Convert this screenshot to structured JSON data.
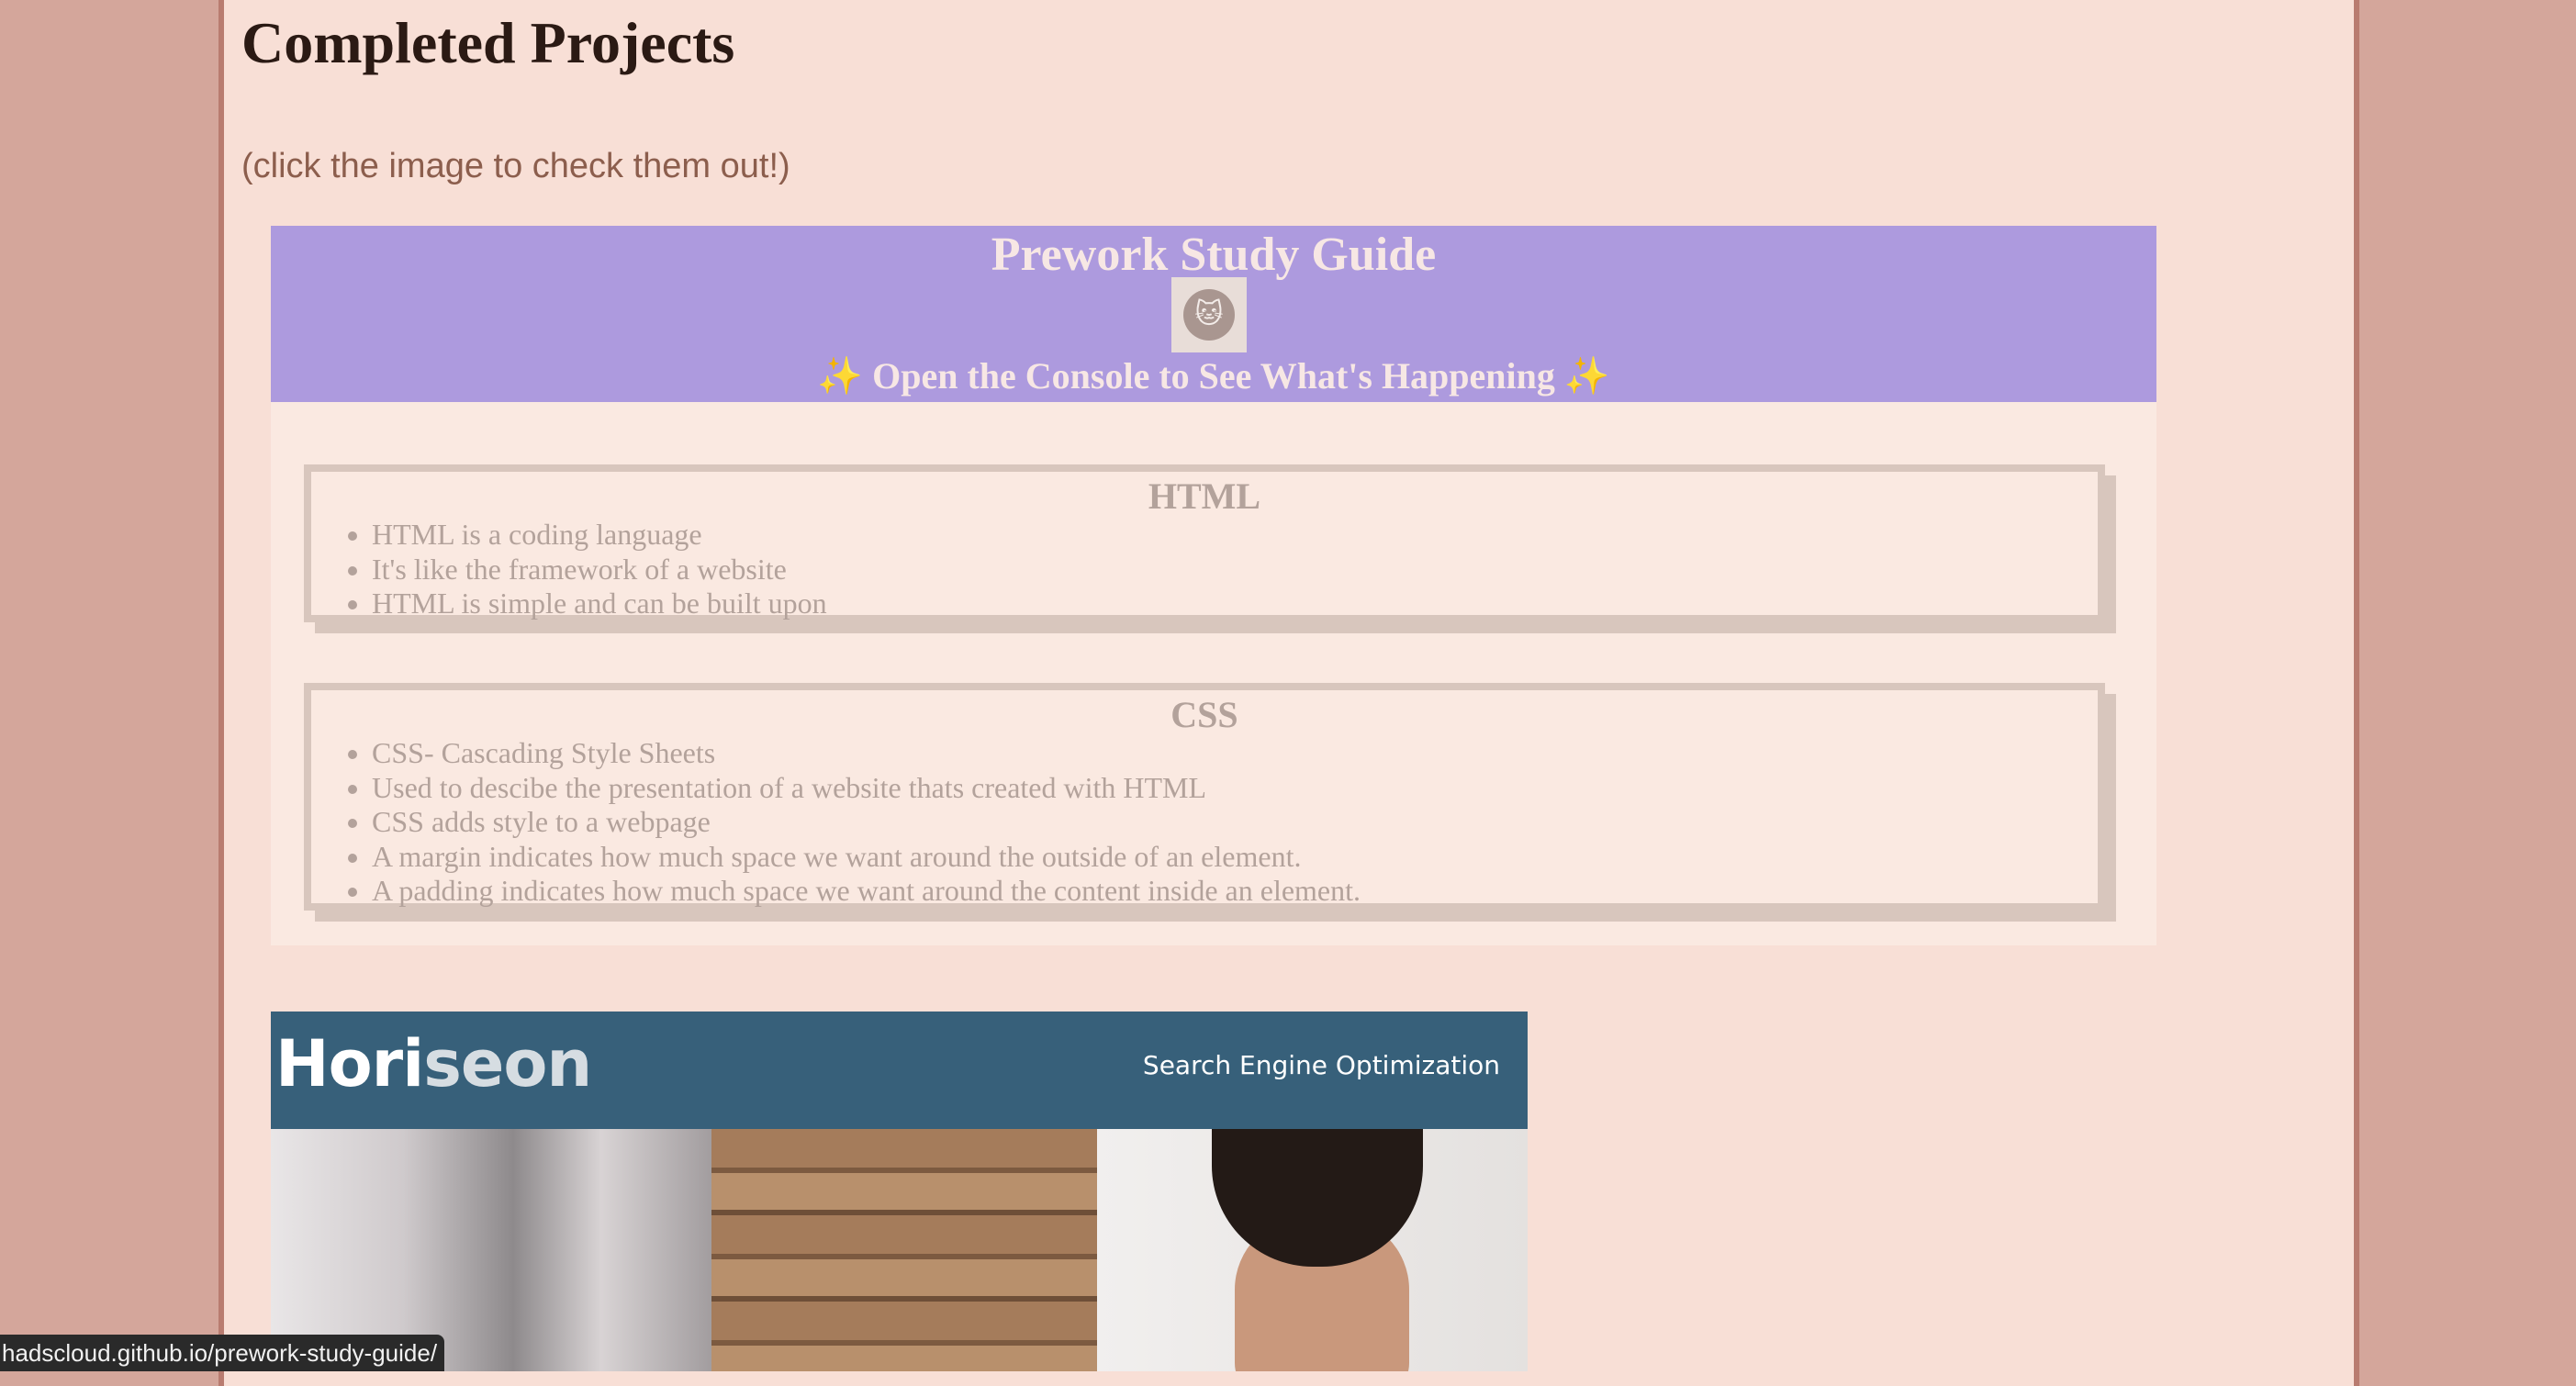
{
  "page": {
    "title": "Completed Projects",
    "subtitle": "(click the image to check them out!)"
  },
  "projects": [
    {
      "header_title": "Prework Study Guide",
      "avatar_icon": "cat-icon",
      "console_text": "Open the Console to See What's Happening",
      "sparkle": "✨",
      "sections": [
        {
          "heading": "HTML",
          "items": [
            "HTML is a coding language",
            "It's like the framework of a website",
            "HTML is simple and can be built upon"
          ]
        },
        {
          "heading": "CSS",
          "items": [
            "CSS- Cascading Style Sheets",
            "Used to descibe the presentation of a website thats created with HTML",
            "CSS adds style to a webpage",
            "A margin indicates how much space we want around the outside of an element.",
            "A padding indicates how much space we want around the content inside an element."
          ]
        }
      ]
    },
    {
      "logo_part1": "Hori",
      "logo_part2": "seon",
      "nav_label": "Search Engine Optimization"
    }
  ],
  "status_bar": {
    "url": "hadscloud.github.io/prework-study-guide/"
  },
  "colors": {
    "background": "#d4a69b",
    "page": "#f8dfd6",
    "study_guide_header": "#ad9ade",
    "horiseon_header": "#37607a"
  }
}
